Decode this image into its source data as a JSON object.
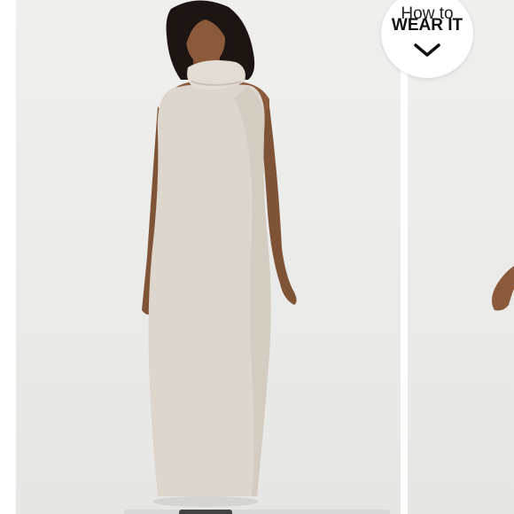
{
  "how_to_wear": {
    "line1": "How to",
    "line2": "WEAR IT",
    "icon": "chevron-down-icon"
  },
  "gallery": {
    "image_index": 1,
    "colors": {
      "background": "#ecebe9",
      "dress": "#ddd6cc",
      "skin": "#8a5a3a",
      "hair": "#1c1512"
    }
  }
}
